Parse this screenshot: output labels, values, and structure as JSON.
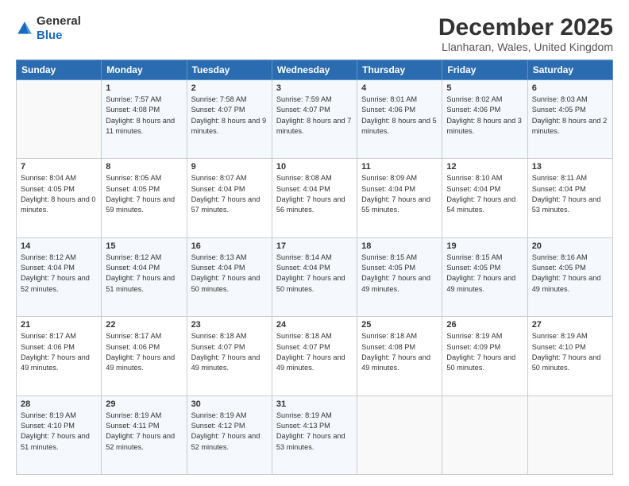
{
  "logo": {
    "general": "General",
    "blue": "Blue"
  },
  "header": {
    "month": "December 2025",
    "location": "Llanharan, Wales, United Kingdom"
  },
  "days_of_week": [
    "Sunday",
    "Monday",
    "Tuesday",
    "Wednesday",
    "Thursday",
    "Friday",
    "Saturday"
  ],
  "weeks": [
    [
      {
        "day": "",
        "sunrise": "",
        "sunset": "",
        "daylight": ""
      },
      {
        "day": "1",
        "sunrise": "Sunrise: 7:57 AM",
        "sunset": "Sunset: 4:08 PM",
        "daylight": "Daylight: 8 hours and 11 minutes."
      },
      {
        "day": "2",
        "sunrise": "Sunrise: 7:58 AM",
        "sunset": "Sunset: 4:07 PM",
        "daylight": "Daylight: 8 hours and 9 minutes."
      },
      {
        "day": "3",
        "sunrise": "Sunrise: 7:59 AM",
        "sunset": "Sunset: 4:07 PM",
        "daylight": "Daylight: 8 hours and 7 minutes."
      },
      {
        "day": "4",
        "sunrise": "Sunrise: 8:01 AM",
        "sunset": "Sunset: 4:06 PM",
        "daylight": "Daylight: 8 hours and 5 minutes."
      },
      {
        "day": "5",
        "sunrise": "Sunrise: 8:02 AM",
        "sunset": "Sunset: 4:06 PM",
        "daylight": "Daylight: 8 hours and 3 minutes."
      },
      {
        "day": "6",
        "sunrise": "Sunrise: 8:03 AM",
        "sunset": "Sunset: 4:05 PM",
        "daylight": "Daylight: 8 hours and 2 minutes."
      }
    ],
    [
      {
        "day": "7",
        "sunrise": "Sunrise: 8:04 AM",
        "sunset": "Sunset: 4:05 PM",
        "daylight": "Daylight: 8 hours and 0 minutes."
      },
      {
        "day": "8",
        "sunrise": "Sunrise: 8:05 AM",
        "sunset": "Sunset: 4:05 PM",
        "daylight": "Daylight: 7 hours and 59 minutes."
      },
      {
        "day": "9",
        "sunrise": "Sunrise: 8:07 AM",
        "sunset": "Sunset: 4:04 PM",
        "daylight": "Daylight: 7 hours and 57 minutes."
      },
      {
        "day": "10",
        "sunrise": "Sunrise: 8:08 AM",
        "sunset": "Sunset: 4:04 PM",
        "daylight": "Daylight: 7 hours and 56 minutes."
      },
      {
        "day": "11",
        "sunrise": "Sunrise: 8:09 AM",
        "sunset": "Sunset: 4:04 PM",
        "daylight": "Daylight: 7 hours and 55 minutes."
      },
      {
        "day": "12",
        "sunrise": "Sunrise: 8:10 AM",
        "sunset": "Sunset: 4:04 PM",
        "daylight": "Daylight: 7 hours and 54 minutes."
      },
      {
        "day": "13",
        "sunrise": "Sunrise: 8:11 AM",
        "sunset": "Sunset: 4:04 PM",
        "daylight": "Daylight: 7 hours and 53 minutes."
      }
    ],
    [
      {
        "day": "14",
        "sunrise": "Sunrise: 8:12 AM",
        "sunset": "Sunset: 4:04 PM",
        "daylight": "Daylight: 7 hours and 52 minutes."
      },
      {
        "day": "15",
        "sunrise": "Sunrise: 8:12 AM",
        "sunset": "Sunset: 4:04 PM",
        "daylight": "Daylight: 7 hours and 51 minutes."
      },
      {
        "day": "16",
        "sunrise": "Sunrise: 8:13 AM",
        "sunset": "Sunset: 4:04 PM",
        "daylight": "Daylight: 7 hours and 50 minutes."
      },
      {
        "day": "17",
        "sunrise": "Sunrise: 8:14 AM",
        "sunset": "Sunset: 4:04 PM",
        "daylight": "Daylight: 7 hours and 50 minutes."
      },
      {
        "day": "18",
        "sunrise": "Sunrise: 8:15 AM",
        "sunset": "Sunset: 4:05 PM",
        "daylight": "Daylight: 7 hours and 49 minutes."
      },
      {
        "day": "19",
        "sunrise": "Sunrise: 8:15 AM",
        "sunset": "Sunset: 4:05 PM",
        "daylight": "Daylight: 7 hours and 49 minutes."
      },
      {
        "day": "20",
        "sunrise": "Sunrise: 8:16 AM",
        "sunset": "Sunset: 4:05 PM",
        "daylight": "Daylight: 7 hours and 49 minutes."
      }
    ],
    [
      {
        "day": "21",
        "sunrise": "Sunrise: 8:17 AM",
        "sunset": "Sunset: 4:06 PM",
        "daylight": "Daylight: 7 hours and 49 minutes."
      },
      {
        "day": "22",
        "sunrise": "Sunrise: 8:17 AM",
        "sunset": "Sunset: 4:06 PM",
        "daylight": "Daylight: 7 hours and 49 minutes."
      },
      {
        "day": "23",
        "sunrise": "Sunrise: 8:18 AM",
        "sunset": "Sunset: 4:07 PM",
        "daylight": "Daylight: 7 hours and 49 minutes."
      },
      {
        "day": "24",
        "sunrise": "Sunrise: 8:18 AM",
        "sunset": "Sunset: 4:07 PM",
        "daylight": "Daylight: 7 hours and 49 minutes."
      },
      {
        "day": "25",
        "sunrise": "Sunrise: 8:18 AM",
        "sunset": "Sunset: 4:08 PM",
        "daylight": "Daylight: 7 hours and 49 minutes."
      },
      {
        "day": "26",
        "sunrise": "Sunrise: 8:19 AM",
        "sunset": "Sunset: 4:09 PM",
        "daylight": "Daylight: 7 hours and 50 minutes."
      },
      {
        "day": "27",
        "sunrise": "Sunrise: 8:19 AM",
        "sunset": "Sunset: 4:10 PM",
        "daylight": "Daylight: 7 hours and 50 minutes."
      }
    ],
    [
      {
        "day": "28",
        "sunrise": "Sunrise: 8:19 AM",
        "sunset": "Sunset: 4:10 PM",
        "daylight": "Daylight: 7 hours and 51 minutes."
      },
      {
        "day": "29",
        "sunrise": "Sunrise: 8:19 AM",
        "sunset": "Sunset: 4:11 PM",
        "daylight": "Daylight: 7 hours and 52 minutes."
      },
      {
        "day": "30",
        "sunrise": "Sunrise: 8:19 AM",
        "sunset": "Sunset: 4:12 PM",
        "daylight": "Daylight: 7 hours and 52 minutes."
      },
      {
        "day": "31",
        "sunrise": "Sunrise: 8:19 AM",
        "sunset": "Sunset: 4:13 PM",
        "daylight": "Daylight: 7 hours and 53 minutes."
      },
      {
        "day": "",
        "sunrise": "",
        "sunset": "",
        "daylight": ""
      },
      {
        "day": "",
        "sunrise": "",
        "sunset": "",
        "daylight": ""
      },
      {
        "day": "",
        "sunrise": "",
        "sunset": "",
        "daylight": ""
      }
    ]
  ]
}
